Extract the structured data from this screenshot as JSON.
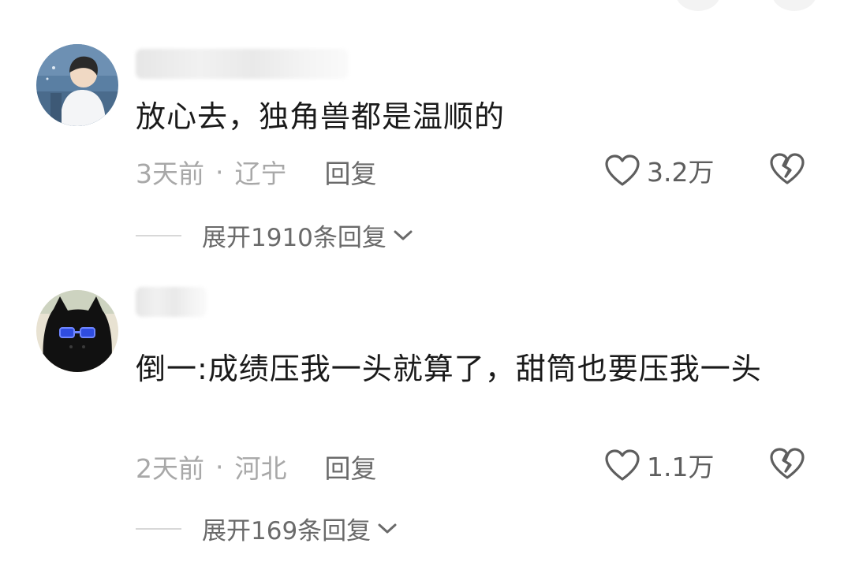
{
  "comments": [
    {
      "text": "放心去，独角兽都是温顺的",
      "time": "3天前",
      "separator": "·",
      "location": "辽宁",
      "reply_label": "回复",
      "likes": "3.2万",
      "expand_label": "展开1910条回复",
      "avatar_icon": "boy-illustration-avatar",
      "like_icon": "heart-outline-icon",
      "dislike_icon": "broken-heart-icon"
    },
    {
      "text": "倒一:成绩压我一头就算了，甜筒也要压我一头",
      "time": "2天前",
      "separator": "·",
      "location": "河北",
      "reply_label": "回复",
      "likes": "1.1万",
      "expand_label": "展开169条回复",
      "avatar_icon": "black-cat-glasses-avatar",
      "like_icon": "heart-outline-icon",
      "dislike_icon": "broken-heart-icon"
    }
  ],
  "colors": {
    "text_primary": "#1a1a1a",
    "text_secondary": "#a8a8a8",
    "text_action": "#6a6a6a",
    "background": "#ffffff"
  }
}
